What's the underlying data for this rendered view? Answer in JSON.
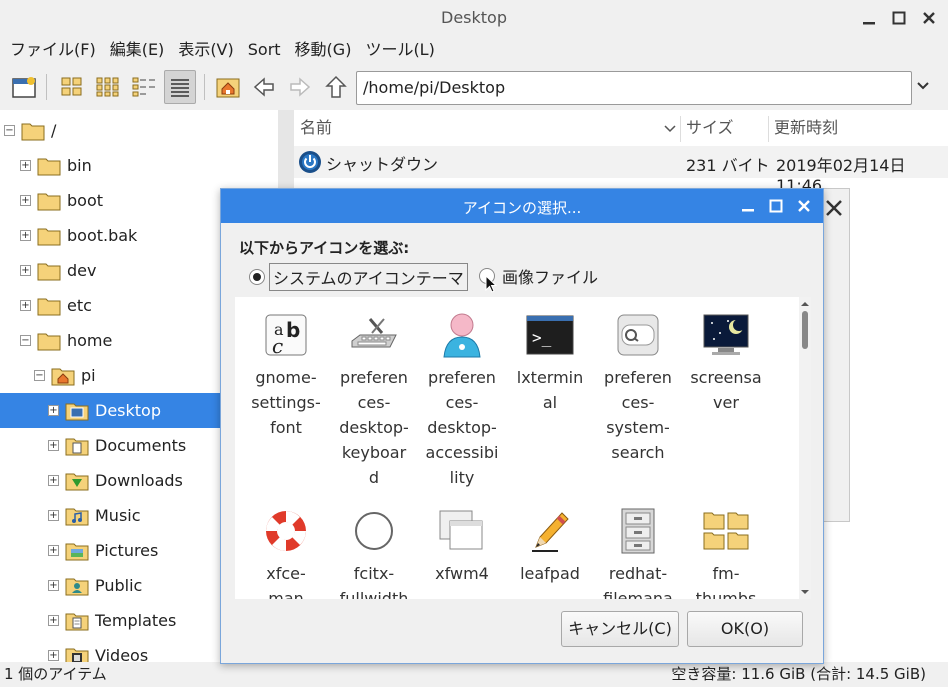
{
  "window": {
    "title": "Desktop"
  },
  "menu": [
    "ファイル(F)",
    "編集(E)",
    "表示(V)",
    "Sort",
    "移動(G)",
    "ツール(L)"
  ],
  "toolbar": {
    "path": "/home/pi/Desktop"
  },
  "tree": [
    {
      "label": "/",
      "expander": "−",
      "icon": "folder-icon"
    },
    {
      "label": "bin",
      "expander": "+",
      "icon": "folder-icon"
    },
    {
      "label": "boot",
      "expander": "+",
      "icon": "folder-icon"
    },
    {
      "label": "boot.bak",
      "expander": "+",
      "icon": "folder-icon"
    },
    {
      "label": "dev",
      "expander": "+",
      "icon": "folder-icon"
    },
    {
      "label": "etc",
      "expander": "+",
      "icon": "folder-icon"
    },
    {
      "label": "home",
      "expander": "−",
      "icon": "folder-icon"
    },
    {
      "label": "pi",
      "expander": "−",
      "icon": "home-folder-icon"
    },
    {
      "label": "Desktop",
      "expander": "+",
      "icon": "desktop-folder-icon"
    },
    {
      "label": "Documents",
      "expander": "+",
      "icon": "documents-folder-icon"
    },
    {
      "label": "Downloads",
      "expander": "+",
      "icon": "downloads-folder-icon"
    },
    {
      "label": "Music",
      "expander": "+",
      "icon": "music-folder-icon"
    },
    {
      "label": "Pictures",
      "expander": "+",
      "icon": "pictures-folder-icon"
    },
    {
      "label": "Public",
      "expander": "+",
      "icon": "public-folder-icon"
    },
    {
      "label": "Templates",
      "expander": "+",
      "icon": "templates-folder-icon"
    },
    {
      "label": "Videos",
      "expander": "+",
      "icon": "videos-folder-icon"
    }
  ],
  "filelist": {
    "columns": {
      "name": "名前",
      "size": "サイズ",
      "modified": "更新時刻"
    },
    "rows": [
      {
        "name": "シャットダウン",
        "size": "231 バイト",
        "modified": "2019年02月14日 11:46"
      }
    ]
  },
  "status": {
    "left": "1 個のアイテム",
    "right": "空き容量: 11.6 GiB (合計: 14.5 GiB)"
  },
  "dialog": {
    "title": "アイコンの選択...",
    "prompt": "以下からアイコンを選ぶ:",
    "radio_theme": "システムのアイコンテーマ",
    "radio_file": "画像ファイル",
    "icons": [
      {
        "label": "gnome-settings-font",
        "icon": "font-icon"
      },
      {
        "label": "preferences-desktop-keyboard",
        "icon": "keyboard-icon"
      },
      {
        "label": "preferences-desktop-accessibility",
        "icon": "accessibility-icon"
      },
      {
        "label": "lxterminal",
        "icon": "terminal-icon"
      },
      {
        "label": "preferences-system-search",
        "icon": "search-icon"
      },
      {
        "label": "screensaver",
        "icon": "screensaver-icon"
      },
      {
        "label": "xfce-man",
        "icon": "lifebuoy-icon"
      },
      {
        "label": "fcitx-fullwidth",
        "icon": "circle-icon"
      },
      {
        "label": "xfwm4",
        "icon": "window-manager-icon"
      },
      {
        "label": "leafpad",
        "icon": "pencil-icon"
      },
      {
        "label": "redhat-filemana",
        "icon": "file-cabinet-icon"
      },
      {
        "label": "fm-thumbs",
        "icon": "thumbnails-icon"
      }
    ],
    "icon_lines": [
      [
        "gnome-",
        "settings-",
        "font"
      ],
      [
        "preferen",
        "ces-",
        "desktop-",
        "keyboar",
        "d"
      ],
      [
        "preferen",
        "ces-",
        "desktop-",
        "accessibi",
        "lity"
      ],
      [
        "lxtermin",
        "al"
      ],
      [
        "preferen",
        "ces-",
        "system-",
        "search"
      ],
      [
        "screensa",
        "ver"
      ],
      [
        "xfce-",
        "man"
      ],
      [
        "fcitx-",
        "fullwidth"
      ],
      [
        "xfwm4"
      ],
      [
        "leafpad"
      ],
      [
        "redhat-",
        "filemana"
      ],
      [
        "fm-",
        "thumbs"
      ]
    ],
    "cancel": "キャンセル(C)",
    "ok": "OK(O)"
  },
  "colors": {
    "accent": "#3584e4",
    "folder": "#f5d27a"
  }
}
